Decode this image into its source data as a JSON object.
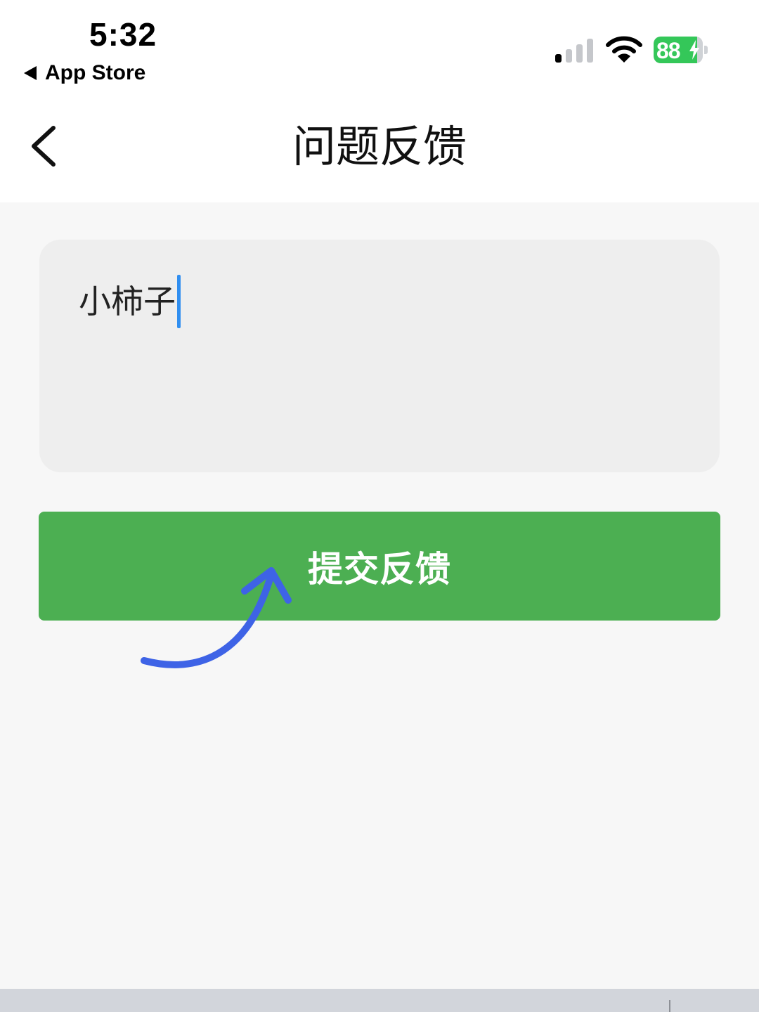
{
  "status_bar": {
    "time": "5:32",
    "back_app_label": "App Store",
    "battery_level": "88",
    "battery_percent": 88,
    "battery_charging": true,
    "signal_bars_active": 1,
    "signal_bars_total": 4
  },
  "header": {
    "title": "问题反馈",
    "back_icon": "chevron-left-icon"
  },
  "feedback": {
    "value": "小柿子",
    "caret_color": "#2f8ef0"
  },
  "submit": {
    "label": "提交反馈",
    "color": "#4caf52"
  },
  "annotation": {
    "type": "arrow",
    "color": "#3e63e6"
  },
  "colors": {
    "background": "#f7f7f7",
    "input_background": "#eeeeee",
    "battery_green": "#34c759"
  }
}
